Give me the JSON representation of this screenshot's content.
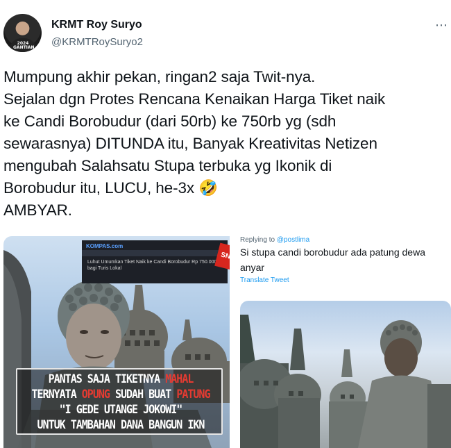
{
  "author": {
    "name": "KRMT Roy Suryo",
    "handle": "@KRMTRoySuryo2",
    "avatar_badge": "2024\nGANTIAN"
  },
  "more_icon": "⋯",
  "tweet": {
    "text": "Mumpung akhir pekan, ringan2 saja Twit-nya.\nSejalan dgn Protes Rencana Kenaikan Harga Tiket naik\nke Candi Borobudur (dari 50rb) ke 750rb yg (sdh\nsewarasnya) DITUNDA itu, Banyak Kreativitas Netizen\nmengubah Salahsatu Stupa terbuka yg Ikonik di\nBorobudur itu, LUCU, he-3x 🤣\nAMBYAR."
  },
  "left_image": {
    "news_logo": "KOMPAS.com",
    "news_headline": "Luhut Umumkan Tiket Naik ke Candi Borobudur Rp 750.000 bagi Turis Lokal",
    "badge": "SN",
    "caption": {
      "line1": "PANTAS SAJA TIKETNYA ",
      "line1_red": "MAHAL",
      "line2": "TERNYATA ",
      "line2_red_a": "OPUNG",
      "line2_mid": " SUDAH BUAT ",
      "line2_red_b": "PATUNG",
      "line3_red": "\"I GEDE UTANGE JOKOWI\"",
      "line4": "UNTUK TAMBAHAN DANA BANGUN IKN"
    }
  },
  "right_card": {
    "reply_prefix": "Replying to ",
    "reply_handle": "@postlima",
    "text": "Si stupa candi borobudur ada patung dewa anyar",
    "translate": "Translate Tweet"
  },
  "colors": {
    "text": "#0f1419",
    "secondary": "#536471",
    "link": "#1d9bf0",
    "caption_red": "#e53b32"
  }
}
